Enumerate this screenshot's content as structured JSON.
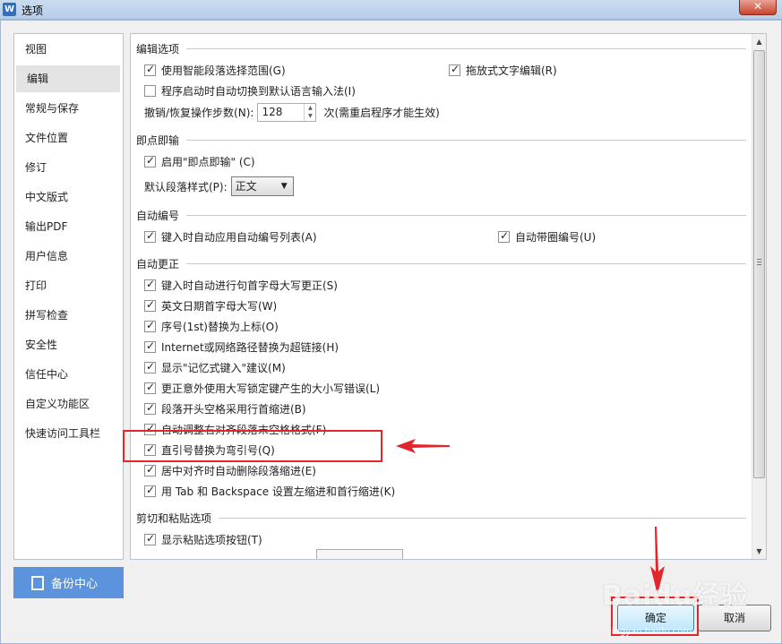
{
  "window": {
    "title": "选项",
    "app_icon": "W",
    "close_glyph": "✕"
  },
  "nav": {
    "items": [
      {
        "label": "视图"
      },
      {
        "label": "编辑",
        "active": true
      },
      {
        "label": "常规与保存"
      },
      {
        "label": "文件位置"
      },
      {
        "label": "修订"
      },
      {
        "label": "中文版式"
      },
      {
        "label": "输出PDF"
      },
      {
        "label": "用户信息"
      },
      {
        "label": "打印"
      },
      {
        "label": "拼写检查"
      },
      {
        "label": "安全性"
      },
      {
        "label": "信任中心"
      },
      {
        "label": "自定义功能区"
      },
      {
        "label": "快速访问工具栏"
      }
    ],
    "backup_label": "备份中心"
  },
  "sections": {
    "edit": {
      "title": "编辑选项",
      "smart_para": {
        "label": "使用智能段落选择范围(G)",
        "checked": true
      },
      "drag_text": {
        "label": "拖放式文字编辑(R)",
        "checked": true
      },
      "auto_ime": {
        "label": "程序启动时自动切换到默认语言输入法(I)",
        "checked": false
      },
      "undo_label": "撤销/恢复操作步数(N):",
      "undo_value": "128",
      "undo_note": "次(需重启程序才能生效)"
    },
    "click_type": {
      "title": "即点即输",
      "enable": {
        "label": "启用\"即点即输\" (C)",
        "checked": true
      },
      "para_style_label": "默认段落样式(P):",
      "para_style_value": "正文"
    },
    "auto_number": {
      "title": "自动编号",
      "auto_list": {
        "label": "键入时自动应用自动编号列表(A)",
        "checked": true
      },
      "auto_circle": {
        "label": "自动带圈编号(U)",
        "checked": true
      }
    },
    "autocorrect": {
      "title": "自动更正",
      "items": [
        {
          "label": "键入时自动进行句首字母大写更正(S)",
          "checked": true
        },
        {
          "label": "英文日期首字母大写(W)",
          "checked": true
        },
        {
          "label": "序号(1st)替换为上标(O)",
          "checked": true
        },
        {
          "label": "Internet或网络路径替换为超链接(H)",
          "checked": true
        },
        {
          "label": "显示\"记忆式键入\"建议(M)",
          "checked": true
        },
        {
          "label": "更正意外使用大写锁定键产生的大小写错误(L)",
          "checked": true
        },
        {
          "label": "段落开头空格采用行首缩进(B)",
          "checked": true
        },
        {
          "label": "自动调整右对齐段落末空格格式(F)",
          "checked": true
        },
        {
          "label": "直引号替换为弯引号(Q)",
          "checked": true
        },
        {
          "label": "居中对齐时自动删除段落缩进(E)",
          "checked": true
        },
        {
          "label": "用 Tab 和 Backspace 设置左缩进和首行缩进(K)",
          "checked": true
        }
      ]
    },
    "paste": {
      "title": "剪切和粘贴选项",
      "show_btn": {
        "label": "显示粘贴选项按钮(T)",
        "checked": true
      }
    }
  },
  "buttons": {
    "ok": "确定",
    "cancel": "取消"
  },
  "watermark": {
    "main": "Baidu经验",
    "sub": "jingyan.baidu.com"
  },
  "colors": {
    "annotation": "#e3262b",
    "backup_bg": "#5b94dc"
  }
}
